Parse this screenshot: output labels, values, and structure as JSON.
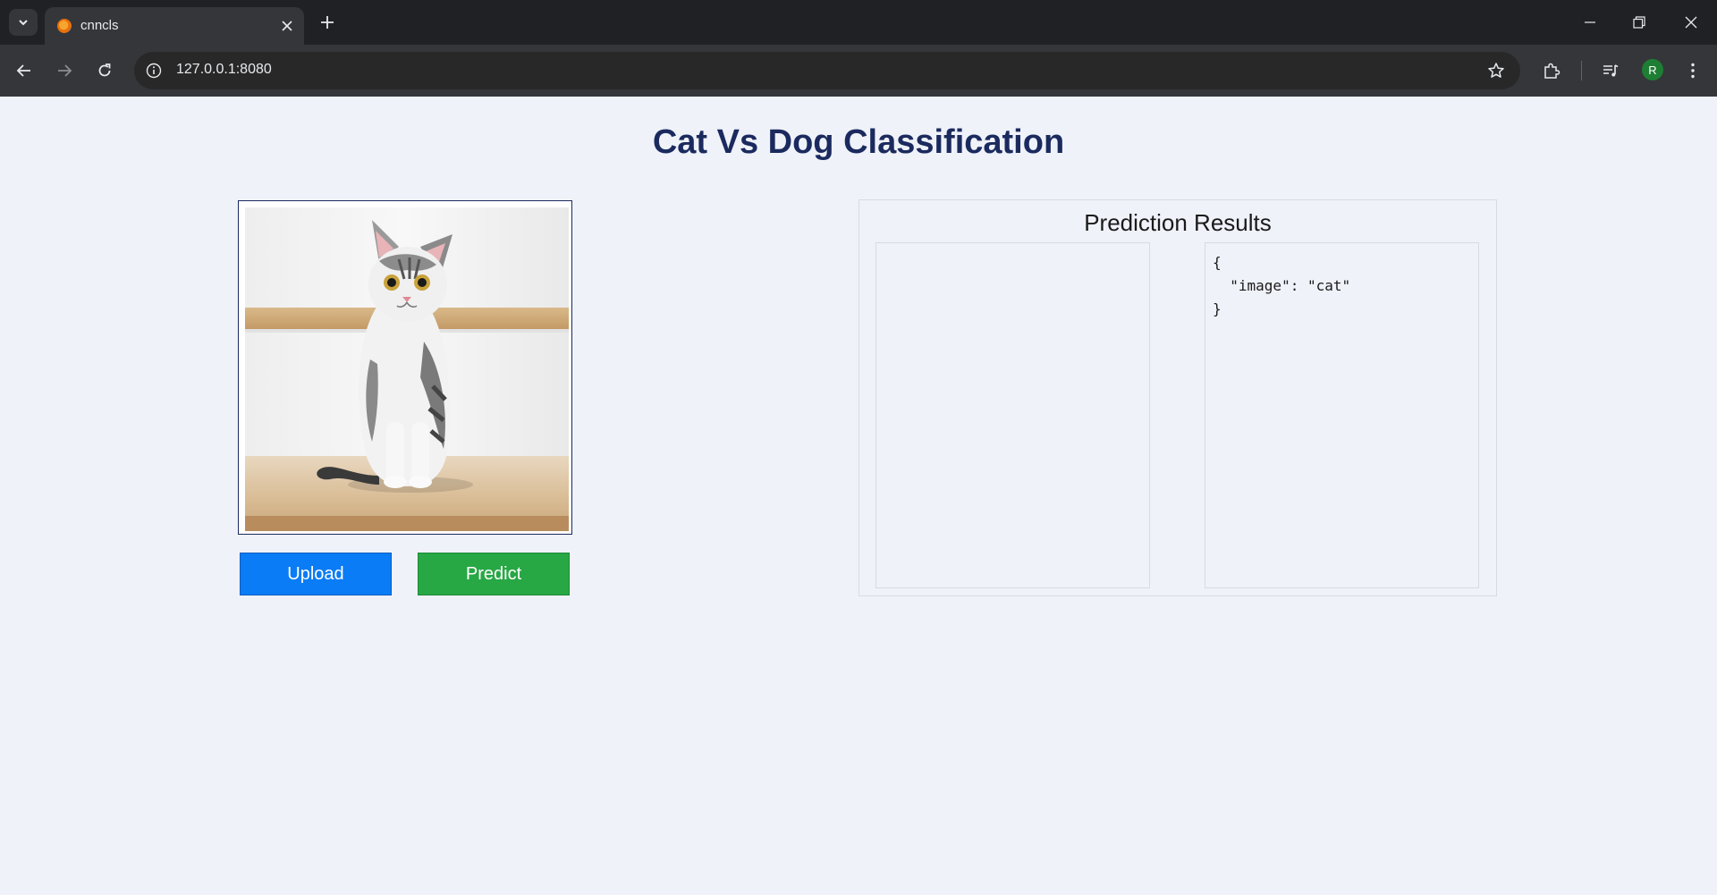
{
  "browser": {
    "tab_title": "cnncls",
    "url": "127.0.0.1:8080",
    "profile_initial": "R",
    "icons": [
      "tab-search-icon",
      "close-icon",
      "plus-icon",
      "minimize-icon",
      "restore-icon",
      "back-arrow-icon",
      "forward-arrow-icon",
      "reload-icon",
      "info-icon",
      "star-icon",
      "extensions-icon",
      "media-icon",
      "more-menu-icon"
    ]
  },
  "page": {
    "title": "Cat Vs Dog Classification",
    "upload_label": "Upload",
    "predict_label": "Predict",
    "results_title": "Prediction Results",
    "result_json": "{\n  \"image\": \"cat\"\n}"
  },
  "colors": {
    "title": "#1b2a5e",
    "upload": "#0a7cf5",
    "predict": "#28a745",
    "background": "#eff2f9"
  }
}
